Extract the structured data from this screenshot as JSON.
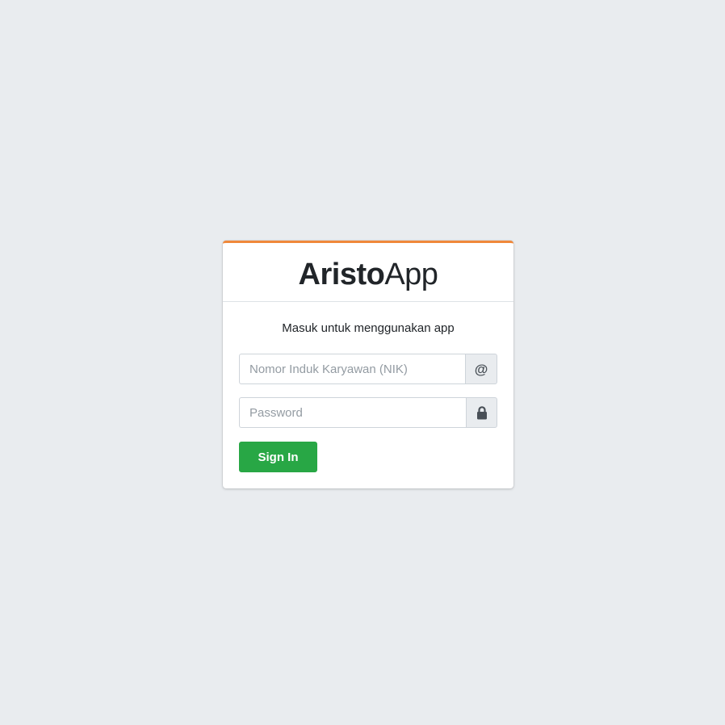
{
  "brand": {
    "bold": "Aristo",
    "light": "App"
  },
  "login": {
    "message": "Masuk untuk menggunakan app",
    "nik_placeholder": "Nomor Induk Karyawan (NIK)",
    "nik_value": "",
    "password_placeholder": "Password",
    "password_value": "",
    "nik_addon_glyph": "@",
    "nik_addon_icon": "at-icon",
    "password_addon_icon": "lock-icon",
    "submit_label": "Sign In"
  },
  "colors": {
    "background": "#e9ecef",
    "card_accent": "#f0883a",
    "primary_button": "#28a745"
  }
}
